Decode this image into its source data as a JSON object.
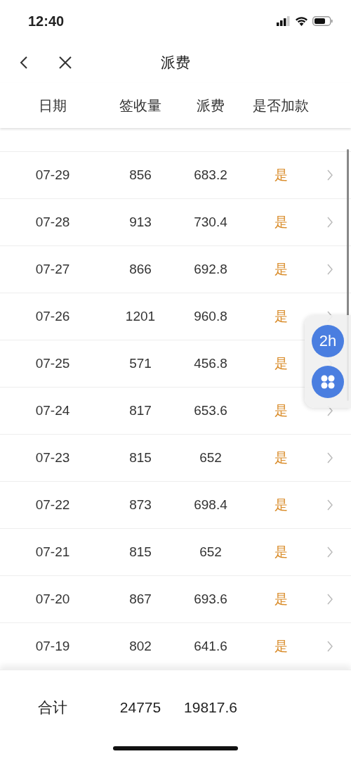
{
  "status_bar": {
    "time": "12:40"
  },
  "nav": {
    "title": "派费"
  },
  "table": {
    "columns": [
      "日期",
      "签收量",
      "派费",
      "是否加款"
    ],
    "rows": [
      {
        "date": "07-29",
        "count": "856",
        "fee": "683.2",
        "extra": "是"
      },
      {
        "date": "07-28",
        "count": "913",
        "fee": "730.4",
        "extra": "是"
      },
      {
        "date": "07-27",
        "count": "866",
        "fee": "692.8",
        "extra": "是"
      },
      {
        "date": "07-26",
        "count": "1201",
        "fee": "960.8",
        "extra": "是"
      },
      {
        "date": "07-25",
        "count": "571",
        "fee": "456.8",
        "extra": "是"
      },
      {
        "date": "07-24",
        "count": "817",
        "fee": "653.6",
        "extra": "是"
      },
      {
        "date": "07-23",
        "count": "815",
        "fee": "652",
        "extra": "是"
      },
      {
        "date": "07-22",
        "count": "873",
        "fee": "698.4",
        "extra": "是"
      },
      {
        "date": "07-21",
        "count": "815",
        "fee": "652",
        "extra": "是"
      },
      {
        "date": "07-20",
        "count": "867",
        "fee": "693.6",
        "extra": "是"
      },
      {
        "date": "07-19",
        "count": "802",
        "fee": "641.6",
        "extra": "是"
      }
    ]
  },
  "float_buttons": {
    "timer": "2h"
  },
  "total": {
    "label": "合计",
    "count": "24775",
    "fee": "19817.6"
  }
}
